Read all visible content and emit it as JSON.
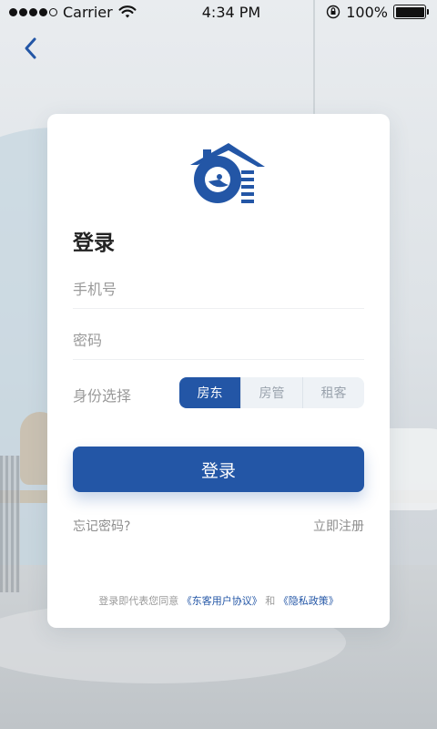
{
  "status_bar": {
    "carrier": "Carrier",
    "time": "4:34 PM",
    "battery": "100%"
  },
  "icons": {
    "back": "chevron-left-icon",
    "logo": "house-bird-logo-icon",
    "wifi": "wifi-icon",
    "lock": "orientation-lock-icon",
    "battery": "battery-icon"
  },
  "login": {
    "title": "登录",
    "phone_placeholder": "手机号",
    "password_placeholder": "密码",
    "role_label": "身份选择",
    "roles": [
      "房东",
      "房管",
      "租客"
    ],
    "selected_role": "房东",
    "submit_label": "登录",
    "forgot_label": "忘记密码?",
    "register_label": "立即注册"
  },
  "agreement": {
    "prefix": "登录即代表您同意",
    "user_agreement": "《东客用户协议》",
    "and": "和",
    "privacy_policy": "《隐私政策》"
  },
  "colors": {
    "accent": "#2356a6",
    "text_muted": "#9a9a9a"
  }
}
